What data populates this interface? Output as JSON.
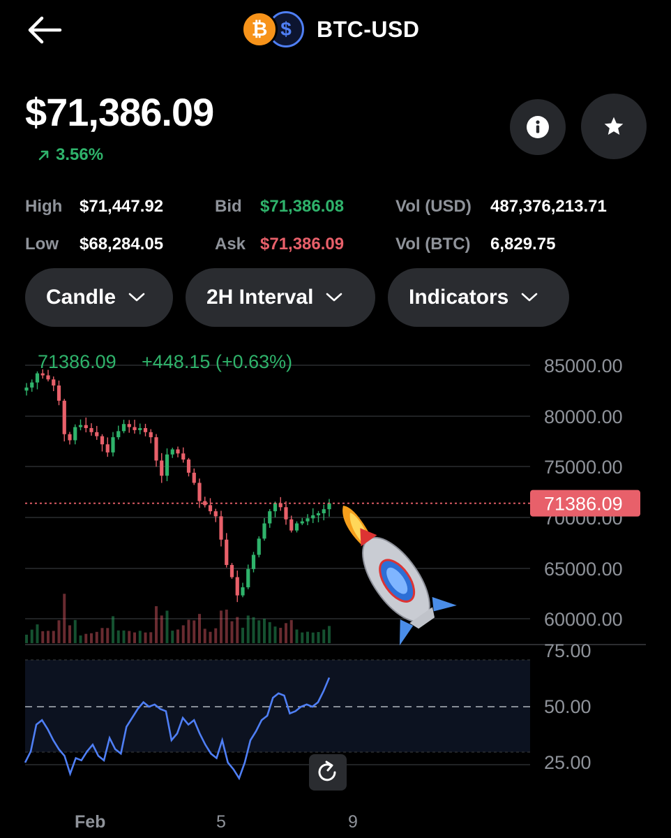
{
  "header": {
    "pair": "BTC-USD",
    "btc_glyph": "₿",
    "usd_glyph": "$",
    "back_icon": "arrow-left-icon"
  },
  "ticker": {
    "price": "$71,386.09",
    "change": "3.56%",
    "change_icon": "arrow-up-right-icon"
  },
  "stats": {
    "high_label": "High",
    "high": "$71,447.92",
    "low_label": "Low",
    "low": "$68,284.05",
    "bid_label": "Bid",
    "bid": "$71,386.08",
    "ask_label": "Ask",
    "ask": "$71,386.09",
    "vol_usd_label": "Vol (USD)",
    "vol_usd": "487,376,213.71",
    "vol_btc_label": "Vol (BTC)",
    "vol_btc": "6,829.75"
  },
  "controls": {
    "chart_type": "Candle",
    "interval": "2H Interval",
    "indicators": "Indicators"
  },
  "chart_header": {
    "last": "71386.09",
    "delta": "+448.15 (+0.63%)"
  },
  "colors": {
    "up": "#2fb36b",
    "down": "#e8606a",
    "rsi_line": "#4f7ff5",
    "panel": "#2a2c30"
  },
  "chart_data": [
    {
      "type": "candlestick",
      "y_ticks": [
        "85000.00",
        "80000.00",
        "75000.00",
        "70000.00",
        "65000.00",
        "60000.00"
      ],
      "ylim": [
        58000,
        86000
      ],
      "current_price_label": "71386.09",
      "current_price": 71386.09,
      "close_series": [
        82800,
        83300,
        84200,
        84000,
        83600,
        83000,
        81500,
        78200,
        77600,
        78900,
        79100,
        78800,
        78400,
        78000,
        77200,
        76400,
        77900,
        78500,
        79200,
        78900,
        78600,
        78800,
        78400,
        77900,
        75600,
        74100,
        76200,
        76700,
        76300,
        75700,
        74400,
        73400,
        71600,
        71200,
        70600,
        70100,
        67800,
        65300,
        64100,
        62300,
        63100,
        64900,
        66300,
        67900,
        69400,
        70600,
        71400,
        71000,
        69800,
        68700,
        69400,
        69600,
        69900,
        70200,
        70400,
        70800,
        71386
      ],
      "x_ticks": [
        "Feb",
        "5",
        "9"
      ]
    },
    {
      "type": "line",
      "title": "",
      "y_ticks": [
        "75.00",
        "50.00",
        "25.00"
      ],
      "ylim": [
        20,
        78
      ],
      "values": [
        25,
        30,
        42,
        44,
        40,
        35,
        31,
        28,
        20,
        27,
        26,
        30,
        33,
        28,
        26,
        36,
        31,
        29,
        41,
        45,
        49,
        52,
        50,
        51,
        49,
        48,
        35,
        38,
        45,
        42,
        44,
        38,
        33,
        29,
        27,
        35,
        25,
        22,
        18,
        25,
        35,
        39,
        44,
        46,
        54,
        56,
        55,
        47,
        48,
        50,
        51,
        50,
        52,
        57,
        63
      ]
    }
  ]
}
